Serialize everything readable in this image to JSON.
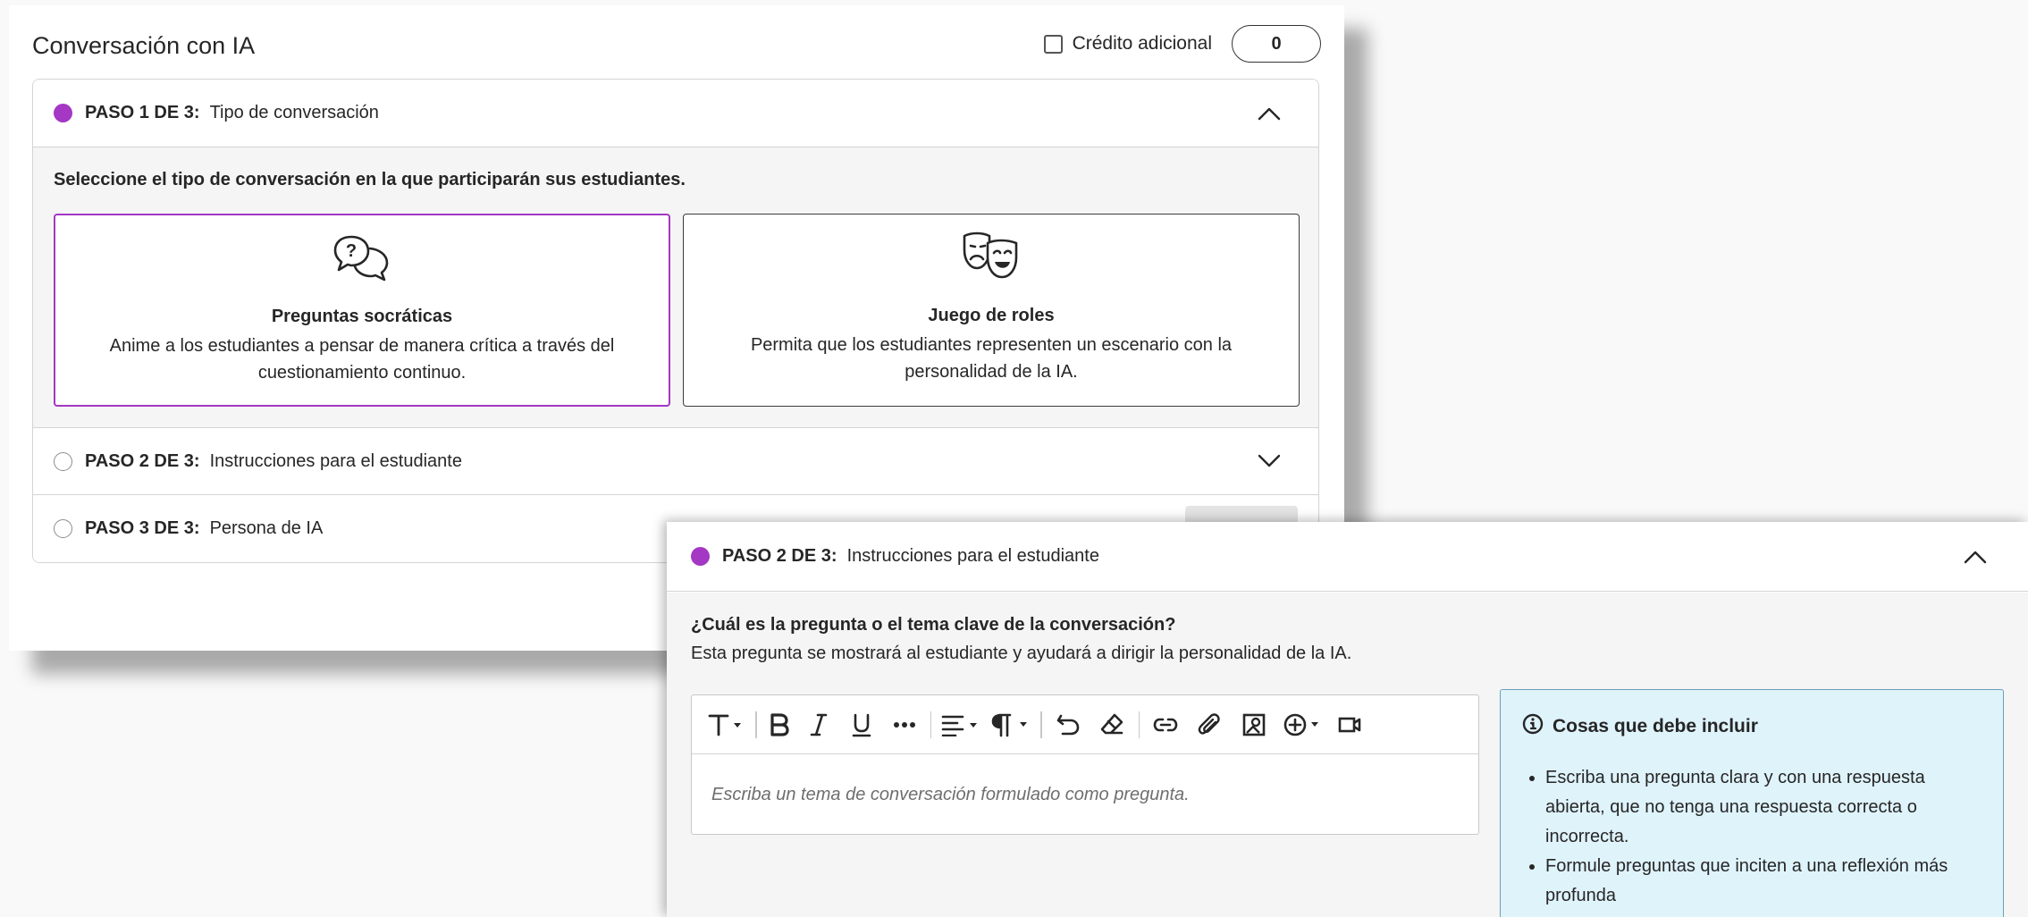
{
  "back_window": {
    "title": "Conversación con IA",
    "credit": {
      "label": "Crédito adicional",
      "checked": false,
      "value": "0"
    },
    "step1": {
      "label": "PASO 1 DE 3:",
      "name": "Tipo de conversación",
      "prompt": "Seleccione el tipo de conversación en la que participarán sus estudiantes.",
      "options": [
        {
          "icon": "speech-bubbles-question-icon",
          "title": "Preguntas socráticas",
          "description": "Anime a los estudiantes a pensar de manera crítica a través del cuestionamiento continuo.",
          "selected": true
        },
        {
          "icon": "theater-masks-icon",
          "title": "Juego de roles",
          "description": "Permita que los estudiantes representen un escenario con la personalidad de la IA.",
          "selected": false
        }
      ]
    },
    "step2": {
      "label": "PASO 2 DE 3:",
      "name": "Instrucciones para el estudiante"
    },
    "step3": {
      "label": "PASO 3 DE 3:",
      "name": "Persona de IA"
    }
  },
  "front_window": {
    "step2": {
      "label": "PASO 2 DE 3:",
      "name": "Instrucciones para el estudiante"
    },
    "question": {
      "title": "¿Cuál es la pregunta o el tema clave de la conversación?",
      "subtitle": "Esta pregunta se mostrará al estudiante y ayudará a dirigir la personalidad de la IA."
    },
    "editor": {
      "placeholder": "Escriba un tema de conversación formulado como pregunta.",
      "toolbar": [
        "text-style-icon",
        "bold-icon",
        "italic-icon",
        "underline-icon",
        "more-icon",
        "align-icon",
        "paragraph-icon",
        "undo-icon",
        "clear-format-icon",
        "link-icon",
        "attach-icon",
        "image-icon",
        "insert-icon",
        "video-icon"
      ]
    },
    "tips": {
      "title": "Cosas que debe incluir",
      "items": [
        "Escriba una pregunta clara y con una respuesta abierta, que no tenga una respuesta correcta o incorrecta.",
        "Formule preguntas que inciten a una reflexión más profunda"
      ]
    }
  },
  "colors": {
    "accent_purple": "#a437c4",
    "info_bg": "#dff3fb",
    "info_border": "#6e9fb5",
    "panel_bg": "#f5f5f5"
  }
}
